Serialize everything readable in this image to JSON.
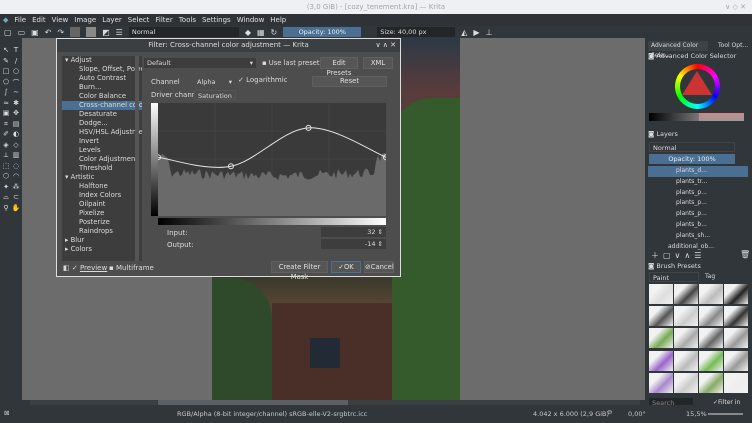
{
  "window": {
    "title": "(3,0 GiB) - [cozy_tenement.kra] — Krita",
    "controls": "∨ ◇ ✕"
  },
  "menu": [
    "File",
    "Edit",
    "View",
    "Image",
    "Layer",
    "Select",
    "Filter",
    "Tools",
    "Settings",
    "Window",
    "Help"
  ],
  "toolbar": {
    "blend_mode": "Normal",
    "opacity": "Opacity: 100%",
    "size": "Size: 40,00 px"
  },
  "dialog": {
    "title": "Filter: Cross-channel color adjustment — Krita",
    "controls": "∨ ∧ ✕",
    "tree": [
      {
        "label": "Adjust",
        "type": "cat"
      },
      {
        "label": "Slope, Offset, Power",
        "type": "it"
      },
      {
        "label": "Auto Contrast",
        "type": "it"
      },
      {
        "label": "Burn...",
        "type": "it"
      },
      {
        "label": "Color Balance",
        "type": "it"
      },
      {
        "label": "Cross-channel color",
        "type": "it",
        "selected": true
      },
      {
        "label": "Desaturate",
        "type": "it"
      },
      {
        "label": "Dodge...",
        "type": "it"
      },
      {
        "label": "HSV/HSL Adjustment",
        "type": "it"
      },
      {
        "label": "Invert",
        "type": "it"
      },
      {
        "label": "Levels",
        "type": "it"
      },
      {
        "label": "Color Adjustment",
        "type": "it"
      },
      {
        "label": "Threshold",
        "type": "it"
      },
      {
        "label": "Artistic",
        "type": "cat"
      },
      {
        "label": "Halftone",
        "type": "it"
      },
      {
        "label": "Index Colors",
        "type": "it"
      },
      {
        "label": "Oilpaint",
        "type": "it"
      },
      {
        "label": "Pixelize",
        "type": "it"
      },
      {
        "label": "Posterize",
        "type": "it"
      },
      {
        "label": "Raindrops",
        "type": "it"
      },
      {
        "label": "Blur",
        "type": "cat"
      },
      {
        "label": "Colors",
        "type": "cat"
      }
    ],
    "preset": "Default",
    "use_last_preset": "Use last preset",
    "edit_presets": "Edit Presets",
    "xml": "XML",
    "channel_label": "Channel",
    "channel": "Alpha",
    "logarithmic": "Logarithmic",
    "reset": "Reset",
    "driver_label": "Driver channel",
    "driver": "Saturation",
    "input_label": "Input:",
    "input": "32",
    "output_label": "Output:",
    "output": "-14",
    "preview": "Preview",
    "multiframe": "Multiframe",
    "create_mask": "Create Filter Mask",
    "ok": "OK",
    "cancel": "Cancel",
    "curve_points": [
      [
        0,
        0.52
      ],
      [
        0.32,
        0.44
      ],
      [
        0.66,
        0.78
      ],
      [
        1,
        0.52
      ]
    ]
  },
  "docker": {
    "tabs": [
      "Advanced Color Sele...",
      "Tool Opt..."
    ],
    "color_selector": "Advanced Color Selector",
    "layers_title": "Layers",
    "layer_blend": "Normal",
    "layer_opacity": "Opacity: 100%",
    "layers": [
      "plants_d...",
      "plants_tr...",
      "plants_p...",
      "plants_p...",
      "plants_p...",
      "plants_b...",
      "plants_sh...",
      "additional_ob..."
    ],
    "brush_title": "Brush Presets",
    "brush_tag": "Paint",
    "tag_label": "Tag",
    "search_placeholder": "Search",
    "filter_in_tag": "Filter in Tag"
  },
  "status": {
    "color_space": "RGB/Alpha (8-bit integer/channel)  sRGB-elle-V2-srgbtrc.icc",
    "dimensions": "4.042 x 6.000 (2,9 GiB)",
    "rotation": "0,00°",
    "zoom": "15,5%"
  }
}
